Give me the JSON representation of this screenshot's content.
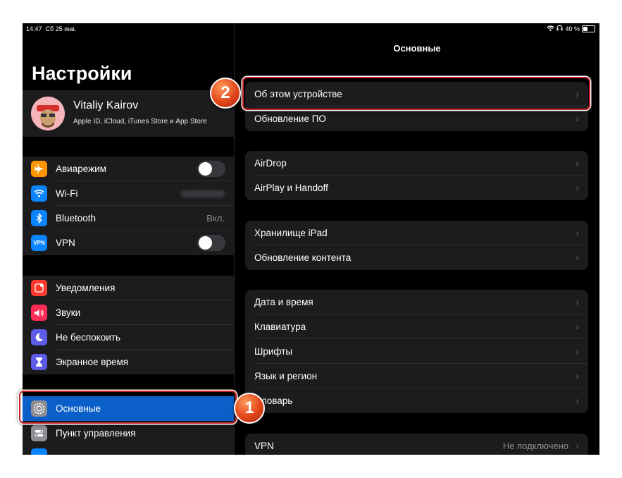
{
  "status": {
    "time": "14:47",
    "date": "Сб 25 янв.",
    "battery_text": "40 %",
    "battery_level": 0.4
  },
  "sidebar": {
    "title": "Настройки",
    "profile": {
      "name": "Vitaliy Kairov",
      "subtitle": "Apple ID, iCloud, iTunes Store и App Store"
    },
    "group1": [
      {
        "label": "Авиарежим",
        "icon": "airplane-icon",
        "color": "#ff9500",
        "toggle": false
      },
      {
        "label": "Wi-Fi",
        "icon": "wifi-icon",
        "color": "#0a84ff"
      },
      {
        "label": "Bluetooth",
        "icon": "bluetooth-icon",
        "color": "#0a84ff",
        "value": "Вкл."
      },
      {
        "label": "VPN",
        "icon": "vpn-icon",
        "color": "#0a84ff",
        "toggle": false
      }
    ],
    "group2": [
      {
        "label": "Уведомления",
        "icon": "notifications-icon",
        "color": "#ff3b30"
      },
      {
        "label": "Звуки",
        "icon": "speaker-icon",
        "color": "#ff2d55"
      },
      {
        "label": "Не беспокоить",
        "icon": "moon-icon",
        "color": "#5e5ce6"
      },
      {
        "label": "Экранное время",
        "icon": "hourglass-icon",
        "color": "#5e5ce6"
      }
    ],
    "group3": [
      {
        "label": "Основные",
        "icon": "gear-icon",
        "selected": true
      },
      {
        "label": "Пункт управления",
        "icon": "control-center-icon"
      }
    ]
  },
  "detail": {
    "title": "Основные",
    "groups": [
      [
        {
          "label": "Об этом устройстве"
        },
        {
          "label": "Обновление ПО"
        }
      ],
      [
        {
          "label": "AirDrop"
        },
        {
          "label": "AirPlay и Handoff"
        }
      ],
      [
        {
          "label": "Хранилище iPad"
        },
        {
          "label": "Обновление контента"
        }
      ],
      [
        {
          "label": "Дата и время"
        },
        {
          "label": "Клавиатура"
        },
        {
          "label": "Шрифты"
        },
        {
          "label": "Язык и регион"
        },
        {
          "label": "Словарь"
        }
      ],
      [
        {
          "label": "VPN",
          "value": "Не подключено"
        }
      ]
    ]
  },
  "callouts": [
    "1",
    "2"
  ],
  "colors": {
    "accent": "#0a60c8",
    "highlight": "#c62128",
    "badge": "#e2451a"
  }
}
